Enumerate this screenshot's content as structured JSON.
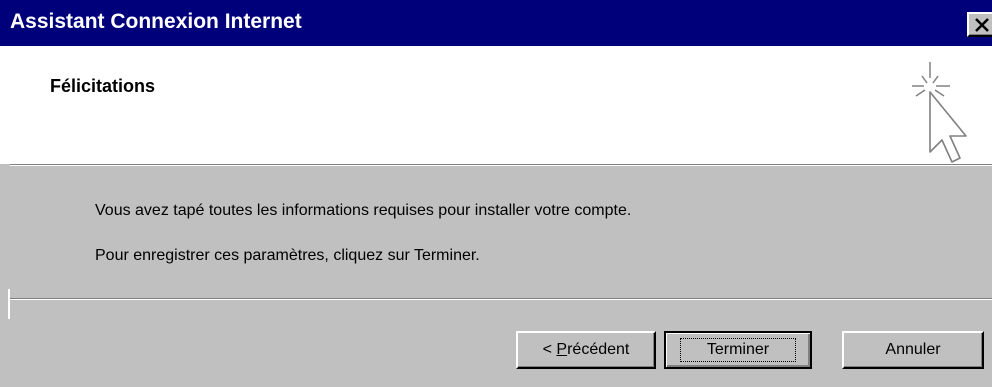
{
  "window": {
    "title": "Assistant Connexion Internet",
    "close_icon": "close-icon",
    "colors": {
      "titlebar": "#00007b",
      "face": "#c0c0c0",
      "header": "#ffffff"
    }
  },
  "header": {
    "title": "Félicitations",
    "icon": "wizard-cursor-icon"
  },
  "body": {
    "line1": "Vous avez tapé toutes les informations requises pour installer votre compte.",
    "line2": "Pour enregistrer ces paramètres, cliquez sur Terminer."
  },
  "buttons": {
    "prev_prefix": "< ",
    "prev_mnemonic": "P",
    "prev_rest": "récédent",
    "finish": "Terminer",
    "cancel": "Annuler"
  }
}
